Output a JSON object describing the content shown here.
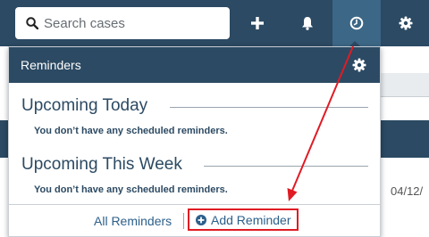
{
  "search": {
    "placeholder": "Search cases",
    "value": ""
  },
  "nav": {
    "add_icon": "plus-icon",
    "notifications_icon": "bell-icon",
    "reminders_icon": "clock-icon",
    "settings_icon": "gear-icon"
  },
  "reminders_dropdown": {
    "title": "Reminders",
    "settings_icon": "gear-icon",
    "sections": [
      {
        "title": "Upcoming Today",
        "empty_message": "You don’t have any scheduled reminders."
      },
      {
        "title": "Upcoming This Week",
        "empty_message": "You don’t have any scheduled reminders."
      }
    ],
    "footer": {
      "all_reminders_label": "All Reminders",
      "add_reminder_label": "Add Reminder",
      "add_reminder_icon": "plus-circle-icon"
    }
  },
  "background": {
    "date_fragment": "04/12/"
  },
  "colors": {
    "navbar": "#2c4a63",
    "navbar_active": "#3c6786",
    "link": "#2c5f8a",
    "annotation_red": "#e01b24"
  }
}
